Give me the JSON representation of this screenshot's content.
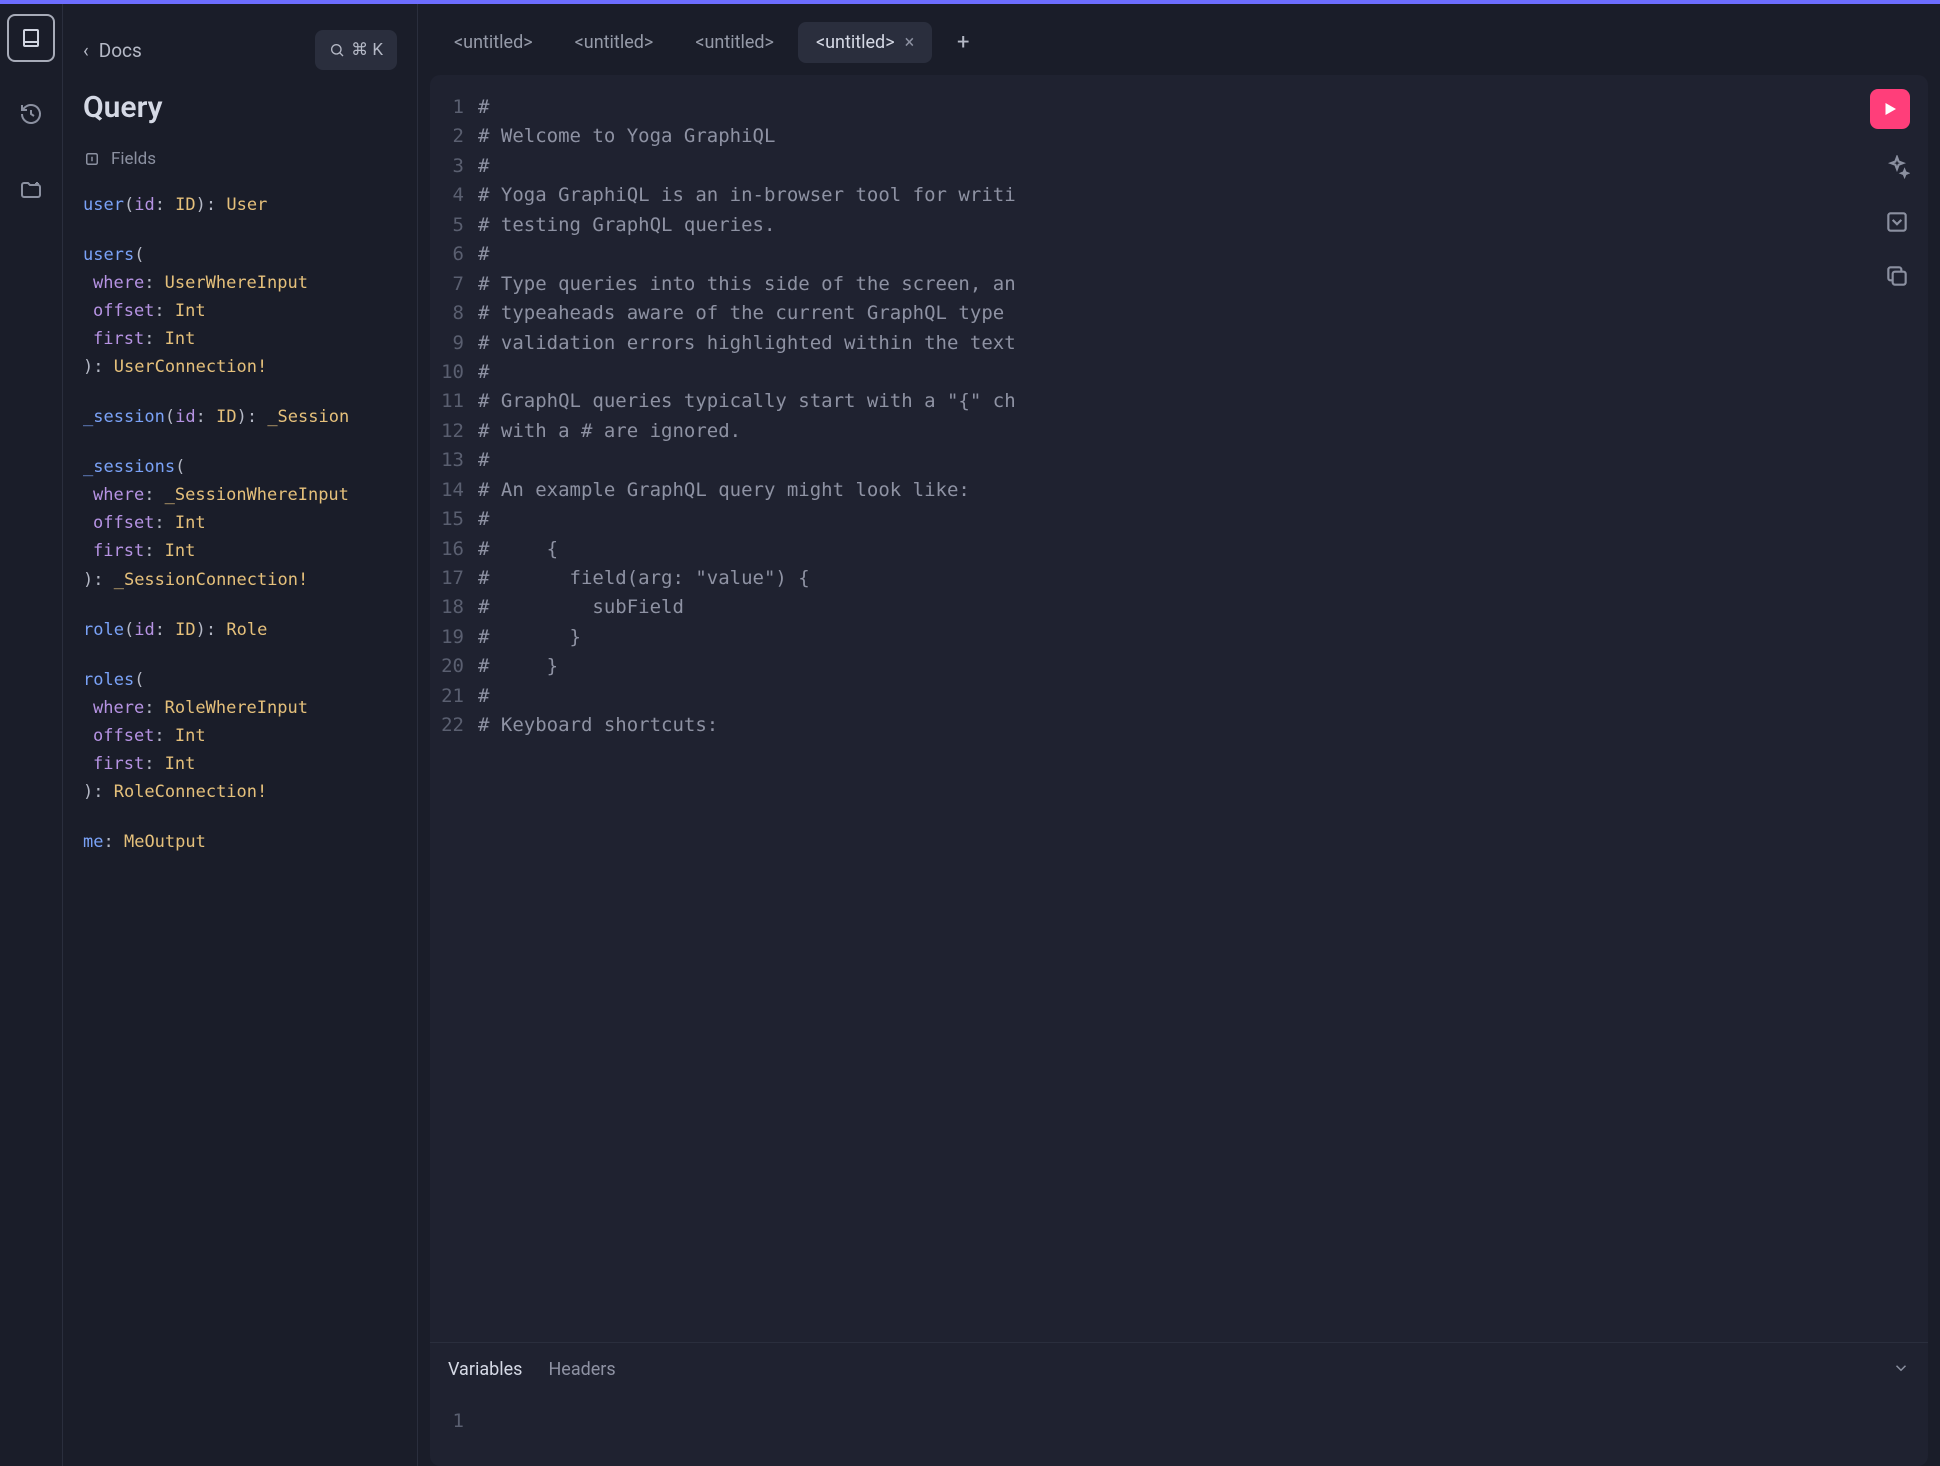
{
  "docs": {
    "back_label": "Docs",
    "title": "Query",
    "fields_label": "Fields",
    "search_shortcut": "⌘ K",
    "fields": [
      {
        "name": "user",
        "args": [
          {
            "name": "id",
            "type": "ID"
          }
        ],
        "ret": "User",
        "bang": false
      },
      {
        "name": "users",
        "args": [
          {
            "name": "where",
            "type": "UserWhereInput"
          },
          {
            "name": "offset",
            "type": "Int"
          },
          {
            "name": "first",
            "type": "Int"
          }
        ],
        "ret": "UserConnection",
        "bang": true,
        "multiline": true
      },
      {
        "name": "_session",
        "args": [
          {
            "name": "id",
            "type": "ID"
          }
        ],
        "ret": "_Session",
        "bang": false
      },
      {
        "name": "_sessions",
        "args": [
          {
            "name": "where",
            "type": "_SessionWhereInput"
          },
          {
            "name": "offset",
            "type": "Int"
          },
          {
            "name": "first",
            "type": "Int"
          }
        ],
        "ret": "_SessionConnection",
        "bang": true,
        "multiline": true
      },
      {
        "name": "role",
        "args": [
          {
            "name": "id",
            "type": "ID"
          }
        ],
        "ret": "Role",
        "bang": false
      },
      {
        "name": "roles",
        "args": [
          {
            "name": "where",
            "type": "RoleWhereInput"
          },
          {
            "name": "offset",
            "type": "Int"
          },
          {
            "name": "first",
            "type": "Int"
          }
        ],
        "ret": "RoleConnection",
        "bang": true,
        "multiline": true
      },
      {
        "name": "me",
        "args": [],
        "ret": "MeOutput",
        "bang": false
      }
    ]
  },
  "tabs": {
    "items": [
      "<untitled>",
      "<untitled>",
      "<untitled>",
      "<untitled>"
    ],
    "active": 3
  },
  "editor": {
    "lines": [
      "#",
      "# Welcome to Yoga GraphiQL",
      "#",
      "# Yoga GraphiQL is an in-browser tool for writi",
      "# testing GraphQL queries.",
      "#",
      "# Type queries into this side of the screen, an",
      "# typeaheads aware of the current GraphQL type ",
      "# validation errors highlighted within the text",
      "#",
      "# GraphQL queries typically start with a \"{\" ch",
      "# with a # are ignored.",
      "#",
      "# An example GraphQL query might look like:",
      "#",
      "#     {",
      "#       field(arg: \"value\") {",
      "#         subField",
      "#       }",
      "#     }",
      "#",
      "# Keyboard shortcuts:"
    ]
  },
  "vars": {
    "tabs": {
      "variables": "Variables",
      "headers": "Headers"
    },
    "active": "variables",
    "lines": [
      ""
    ]
  }
}
